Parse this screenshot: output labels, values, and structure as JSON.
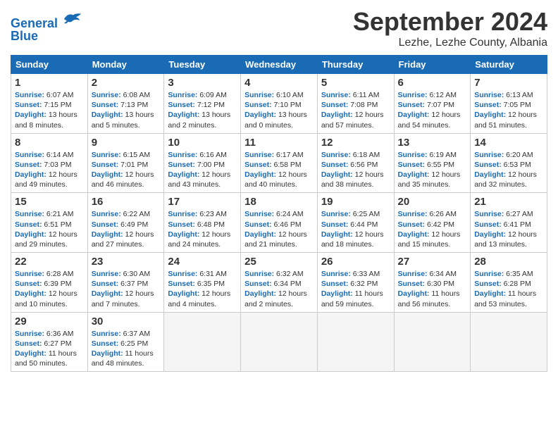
{
  "header": {
    "logo_line1": "General",
    "logo_line2": "Blue",
    "month": "September 2024",
    "location": "Lezhe, Lezhe County, Albania"
  },
  "columns": [
    "Sunday",
    "Monday",
    "Tuesday",
    "Wednesday",
    "Thursday",
    "Friday",
    "Saturday"
  ],
  "weeks": [
    [
      {
        "day": "1",
        "sunrise": "6:07 AM",
        "sunset": "7:15 PM",
        "daylight": "13 hours and 8 minutes."
      },
      {
        "day": "2",
        "sunrise": "6:08 AM",
        "sunset": "7:13 PM",
        "daylight": "13 hours and 5 minutes."
      },
      {
        "day": "3",
        "sunrise": "6:09 AM",
        "sunset": "7:12 PM",
        "daylight": "13 hours and 2 minutes."
      },
      {
        "day": "4",
        "sunrise": "6:10 AM",
        "sunset": "7:10 PM",
        "daylight": "13 hours and 0 minutes."
      },
      {
        "day": "5",
        "sunrise": "6:11 AM",
        "sunset": "7:08 PM",
        "daylight": "12 hours and 57 minutes."
      },
      {
        "day": "6",
        "sunrise": "6:12 AM",
        "sunset": "7:07 PM",
        "daylight": "12 hours and 54 minutes."
      },
      {
        "day": "7",
        "sunrise": "6:13 AM",
        "sunset": "7:05 PM",
        "daylight": "12 hours and 51 minutes."
      }
    ],
    [
      {
        "day": "8",
        "sunrise": "6:14 AM",
        "sunset": "7:03 PM",
        "daylight": "12 hours and 49 minutes."
      },
      {
        "day": "9",
        "sunrise": "6:15 AM",
        "sunset": "7:01 PM",
        "daylight": "12 hours and 46 minutes."
      },
      {
        "day": "10",
        "sunrise": "6:16 AM",
        "sunset": "7:00 PM",
        "daylight": "12 hours and 43 minutes."
      },
      {
        "day": "11",
        "sunrise": "6:17 AM",
        "sunset": "6:58 PM",
        "daylight": "12 hours and 40 minutes."
      },
      {
        "day": "12",
        "sunrise": "6:18 AM",
        "sunset": "6:56 PM",
        "daylight": "12 hours and 38 minutes."
      },
      {
        "day": "13",
        "sunrise": "6:19 AM",
        "sunset": "6:55 PM",
        "daylight": "12 hours and 35 minutes."
      },
      {
        "day": "14",
        "sunrise": "6:20 AM",
        "sunset": "6:53 PM",
        "daylight": "12 hours and 32 minutes."
      }
    ],
    [
      {
        "day": "15",
        "sunrise": "6:21 AM",
        "sunset": "6:51 PM",
        "daylight": "12 hours and 29 minutes."
      },
      {
        "day": "16",
        "sunrise": "6:22 AM",
        "sunset": "6:49 PM",
        "daylight": "12 hours and 27 minutes."
      },
      {
        "day": "17",
        "sunrise": "6:23 AM",
        "sunset": "6:48 PM",
        "daylight": "12 hours and 24 minutes."
      },
      {
        "day": "18",
        "sunrise": "6:24 AM",
        "sunset": "6:46 PM",
        "daylight": "12 hours and 21 minutes."
      },
      {
        "day": "19",
        "sunrise": "6:25 AM",
        "sunset": "6:44 PM",
        "daylight": "12 hours and 18 minutes."
      },
      {
        "day": "20",
        "sunrise": "6:26 AM",
        "sunset": "6:42 PM",
        "daylight": "12 hours and 15 minutes."
      },
      {
        "day": "21",
        "sunrise": "6:27 AM",
        "sunset": "6:41 PM",
        "daylight": "12 hours and 13 minutes."
      }
    ],
    [
      {
        "day": "22",
        "sunrise": "6:28 AM",
        "sunset": "6:39 PM",
        "daylight": "12 hours and 10 minutes."
      },
      {
        "day": "23",
        "sunrise": "6:30 AM",
        "sunset": "6:37 PM",
        "daylight": "12 hours and 7 minutes."
      },
      {
        "day": "24",
        "sunrise": "6:31 AM",
        "sunset": "6:35 PM",
        "daylight": "12 hours and 4 minutes."
      },
      {
        "day": "25",
        "sunrise": "6:32 AM",
        "sunset": "6:34 PM",
        "daylight": "12 hours and 2 minutes."
      },
      {
        "day": "26",
        "sunrise": "6:33 AM",
        "sunset": "6:32 PM",
        "daylight": "11 hours and 59 minutes."
      },
      {
        "day": "27",
        "sunrise": "6:34 AM",
        "sunset": "6:30 PM",
        "daylight": "11 hours and 56 minutes."
      },
      {
        "day": "28",
        "sunrise": "6:35 AM",
        "sunset": "6:28 PM",
        "daylight": "11 hours and 53 minutes."
      }
    ],
    [
      {
        "day": "29",
        "sunrise": "6:36 AM",
        "sunset": "6:27 PM",
        "daylight": "11 hours and 50 minutes."
      },
      {
        "day": "30",
        "sunrise": "6:37 AM",
        "sunset": "6:25 PM",
        "daylight": "11 hours and 48 minutes."
      },
      null,
      null,
      null,
      null,
      null
    ]
  ]
}
